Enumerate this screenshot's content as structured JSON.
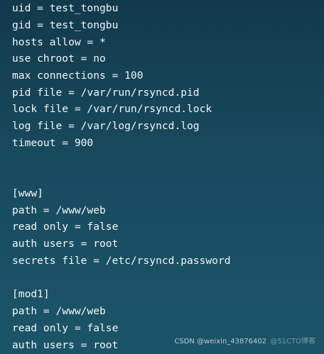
{
  "editor": {
    "lines": [
      "uid = test_tongbu",
      "gid = test_tongbu",
      "hosts allow = *",
      "use chroot = no",
      "max connections = 100",
      "pid file = /var/run/rsyncd.pid",
      "lock file = /var/run/rsyncd.lock",
      "log file = /var/log/rsyncd.log",
      "timeout = 900",
      "[www]",
      "path = /www/web",
      "read only = false",
      "auth users = root",
      "secrets file = /etc/rsyncd.password",
      "[mod1]",
      "path = /www/web",
      "read only = false",
      "auth users = root"
    ]
  },
  "watermark": {
    "part1": "CSDN @weixin_43876402",
    "part2": "@51CTO博客"
  },
  "colors": {
    "background_top": "#123a4c",
    "background_bottom": "#1b5468",
    "text": "#f2f6f8"
  }
}
